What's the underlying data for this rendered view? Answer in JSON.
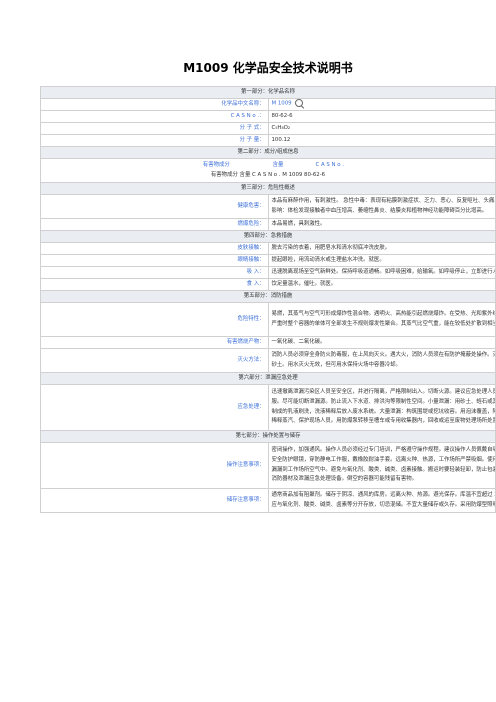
{
  "doc_title": "M1009 化学品安全技术说明书",
  "s1": {
    "header": "第一部分：化学品名称",
    "rows": [
      {
        "label": "化学品中文名称：",
        "value": "M 1009"
      },
      {
        "label": "C A S N o .：",
        "value": "80-62-6"
      },
      {
        "label": "分 子 式：",
        "value": "C₅H₈O₂"
      },
      {
        "label": "分 子 量：",
        "value": "100.12"
      }
    ]
  },
  "s2": {
    "header": "第二部分：成分/组成信息",
    "col1": "有害物成分",
    "col2": "含量",
    "col3": "C A S  N o .",
    "line": "有害物成分  含量  C A S  N o . M 1009 80-62-6"
  },
  "s3": {
    "header": "第三部分：危险性概述",
    "health_label": "健康危害：",
    "health_l1": "本品有麻醉作用，有刺激性。 急性中毒：表现有粘膜刺激症状、乏力、恶心、反复呕吐、头痛、头晕、胸闷，有",
    "health_l2": "影响：体检发现接触者中血压增高、萎缩性鼻炎、结膜炎和植物神经功能障碍百分比增高。",
    "fire_label": "燃爆危险：",
    "fire": "本品易燃，具刺激性。"
  },
  "s4": {
    "header": "第四部分：急救措施",
    "rows": [
      {
        "label": "皮肤接触：",
        "value": "脱去污染的衣着，用肥皂水和清水彻底冲洗皮肤。"
      },
      {
        "label": "眼睛接触：",
        "value": "提起眼睑，用流动清水或生理盐水冲洗。就医。"
      },
      {
        "label": "吸  入：",
        "value": "迅速脱离现场至空气新鲜处。保持呼吸道通畅。如呼吸困难，给输氧。如呼吸停止，立即进行人工呼吸。就医。"
      },
      {
        "label": "食  入：",
        "value": "饮足量温水，催吐。就医。"
      }
    ]
  },
  "s5": {
    "header": "第五部分：消防措施",
    "danger_label": "危险特性：",
    "danger_l1": "易燃，其蒸气与空气可形成爆炸性混合物。遇明火、高热能引起燃烧爆炸。在受热、光和紫外线的作用下易发生聚合，",
    "danger_l2": "严重时整个容器的单体可全部发生不规则爆发性聚合。其蒸气比空气重，能在较低处扩散到相当远的地方，遇火源会着火",
    "products_label": "有害燃烧产物：",
    "products": "一氧化碳、二氧化碳。",
    "method_label": "灭火方法：",
    "method_l1": "消防人员必须穿全身防火防毒服，在上风向灭火。遇大火，消防人员须在有防护掩蔽处操作。灭火剂：抗溶性泡沫、二",
    "method_l2": "砂土。用水灭火无效，但可用水保持火场中容器冷却。"
  },
  "s6": {
    "header": "第六部分：泄漏应急处理",
    "label": "应急处理：",
    "l1": "迅速撤离泄漏污染区人员至安全区，并进行隔离，严格限制出入。切断火源。建议应急处理人员戴自给正压式呼吸器，",
    "l2": "服。尽可能切断泄漏源。防止流入下水道、排洪沟等限制性空间。小量泄漏：用砂土、蛭石或其它惰性材料吸收。或用",
    "l3": "制成的乳液刷洗，洗液稀释后放入废水系统。大量泄漏：构筑围堤或挖坑收容。用泡沫覆盖，降低蒸气灾害。喷雾状水",
    "l4": "稀释蒸汽、保护现场人员。用防爆泵转移至槽车或专用收集器内，回收或运至废物处理场所处置。"
  },
  "s7": {
    "header": "第七部分：操作处置与储存",
    "op_label": "操作注意事项：",
    "op_l1": "密闭操作，加强通风。操作人员必须经过专门培训，严格遵守操作规程。建议操作人员佩戴自吸过滤式防毒面具（半面罩",
    "op_l2": "安全防护眼镜，穿防静电工作服，戴橡胶耐油手套。远离火种、热源，工作场所严禁吸烟。使用防爆型的通风系统和设",
    "op_l3": "漏漏到工作场所空气中。避免与氧化剂、酸类、碱类、卤素接触。搬运时要轻装轻卸，防止包装及容器损坏。配备相应",
    "op_l4": "消防器材及泄漏应急处理设备。倒空的容器可能残留有害物。",
    "st_label": "储存注意事项：",
    "st_l1": "通常商品加有阻聚剂。储存于阴凉、通风的库房。远离火种、热源。避光保存。库温不宜超过 30℃。包装要求密封，不可",
    "st_l2": "应与氧化剂、酸类、碱类、卤素等分开存放，切忌混储。不宜大量储存或久存。采用防爆型照明、通风设施。禁止使用易"
  }
}
